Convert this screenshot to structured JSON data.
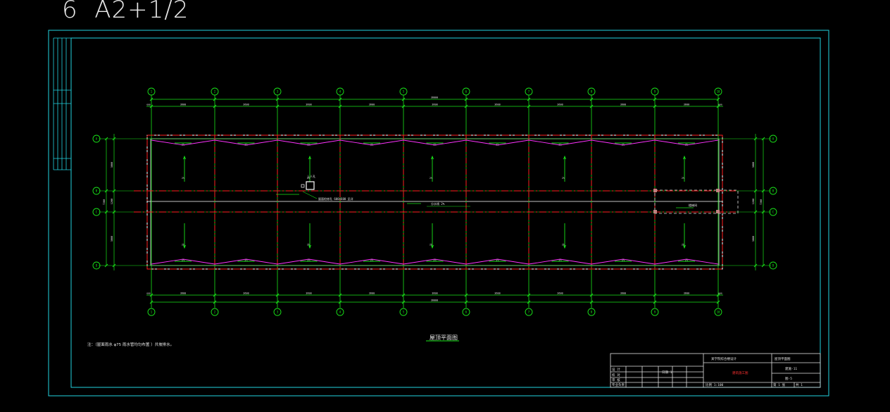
{
  "sheet_label": "6  A2+1/2",
  "colors": {
    "frame": "#22d3e0",
    "grid": "#19e619",
    "axis": "#ff2020",
    "beam": "#ff33ff",
    "wall": "#ffffff",
    "text_red": "#ff3030"
  },
  "drawing": {
    "title": "屋顶平面图",
    "note": "注：（屋面雨水 φ75 雨水管均匀布置 ）共坡排水。",
    "top_total": "36000",
    "bottom_total": "36000",
    "top_spans": [
      "3600",
      "3600",
      "3600",
      "3600",
      "3600",
      "3600",
      "3600",
      "3600",
      "3600"
    ],
    "bottom_spans": [
      "3600",
      "3600",
      "3600",
      "3600",
      "3600",
      "3600",
      "3600",
      "3600",
      "3600"
    ],
    "top_end_left": "600",
    "top_end_right": "600",
    "side_spans": [
      "3000",
      "1200",
      "3000"
    ],
    "side_total": "7200",
    "column_axes": [
      "1",
      "2",
      "3",
      "4",
      "5",
      "6",
      "7",
      "8",
      "9",
      "10"
    ],
    "row_axes": [
      "A",
      "B",
      "C",
      "D"
    ],
    "slope_label": "2%",
    "ridge_label": "分水线 2%",
    "stair_label": "楼梯间",
    "hatch_label": "上人孔",
    "drain_label": "屋面检修孔 600×600 见详",
    "aux_label": "出屋面"
  },
  "title_block": {
    "project": "某学院综合楼设计",
    "drawing_name": "屋顶平面图",
    "red_text": "建筑施工图",
    "drawing_no": "建施-11",
    "sheet_no": "图-5",
    "rows": [
      "设 计",
      "校 对",
      "审 核",
      "专业负责"
    ],
    "scale": "比例 1:100",
    "date": "日期 1",
    "sheet": "第 1 张",
    "total": "共 1"
  }
}
